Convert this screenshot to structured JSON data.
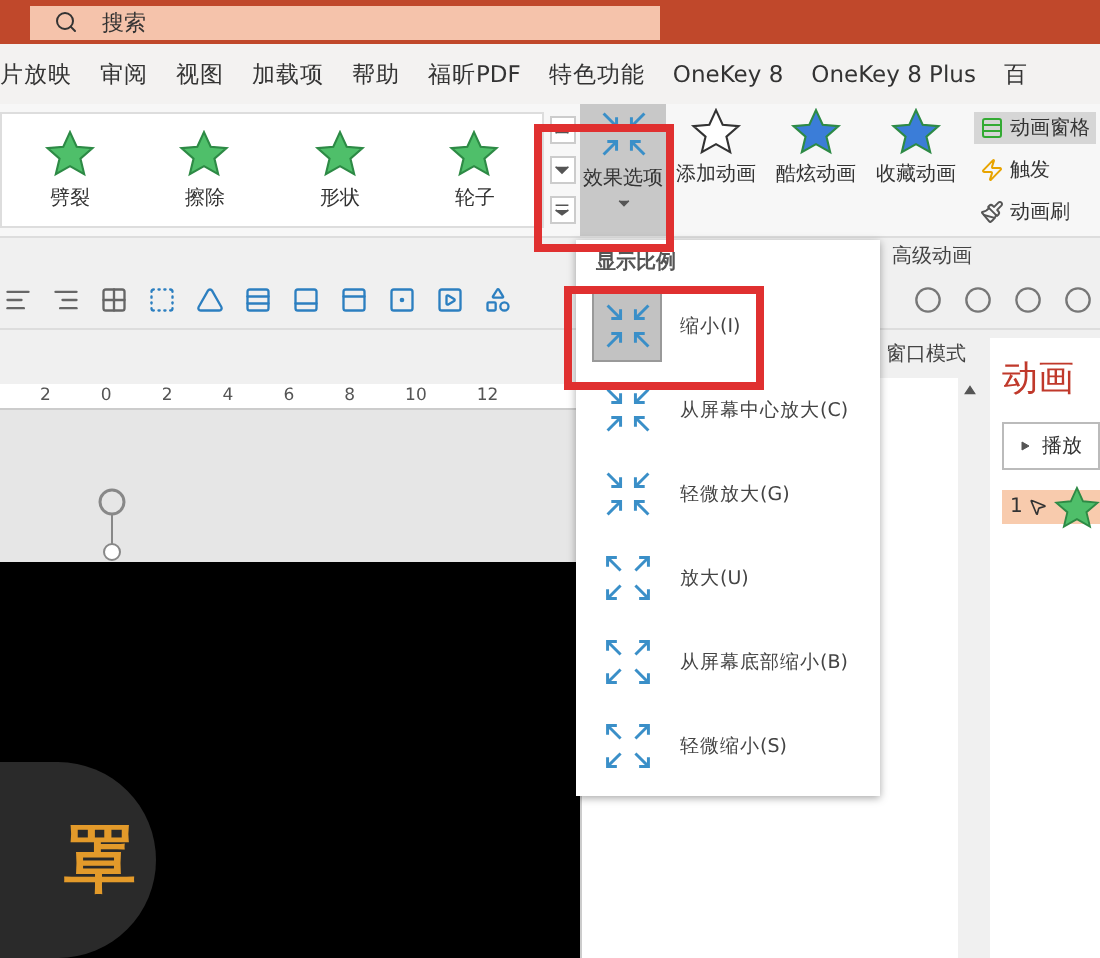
{
  "title_bar": {
    "search": {
      "placeholder": "搜索"
    }
  },
  "tabs": [
    {
      "label": "片放映"
    },
    {
      "label": "审阅"
    },
    {
      "label": "视图"
    },
    {
      "label": "加载项"
    },
    {
      "label": "帮助"
    },
    {
      "label": "福昕PDF"
    },
    {
      "label": "特色功能"
    },
    {
      "label": "OneKey 8"
    },
    {
      "label": "OneKey 8 Plus"
    },
    {
      "label": "百"
    }
  ],
  "ribbon": {
    "gallery": [
      {
        "label": "劈裂"
      },
      {
        "label": "擦除"
      },
      {
        "label": "形状"
      },
      {
        "label": "轮子"
      }
    ],
    "effect_options": {
      "label": "效果选项",
      "selected": true
    },
    "buttons": [
      {
        "label": "添加动画",
        "kind": "outline"
      },
      {
        "label": "酷炫动画",
        "kind": "fancy"
      },
      {
        "label": "收藏动画",
        "kind": "cloud"
      }
    ],
    "side_buttons": [
      {
        "label": "动画窗格",
        "kind": "pane",
        "selected": true
      },
      {
        "label": "触发",
        "kind": "trigger",
        "selected": false
      },
      {
        "label": "动画刷",
        "kind": "brush",
        "selected": false
      }
    ],
    "group_label": "高级动画"
  },
  "ruler": [
    "2",
    "0",
    "2",
    "4",
    "6",
    "8",
    "10",
    "12"
  ],
  "side_pane": {
    "tab": "窗口模式"
  },
  "animation_pane": {
    "title": "动画",
    "play_button": "播放",
    "items": [
      {
        "number": "1"
      }
    ]
  },
  "slide": {
    "text": "罩"
  },
  "dropdown": {
    "header": "显示比例",
    "items": [
      {
        "label": "缩小(I)",
        "kind": "shrink",
        "selected": true
      },
      {
        "label": "从屏幕中心放大(C)",
        "kind": "shrink",
        "selected": false
      },
      {
        "label": "轻微放大(G)",
        "kind": "shrink",
        "selected": false
      },
      {
        "label": "放大(U)",
        "kind": "grow",
        "selected": false
      },
      {
        "label": "从屏幕底部缩小(B)",
        "kind": "grow",
        "selected": false
      },
      {
        "label": "轻微缩小(S)",
        "kind": "grow",
        "selected": false
      }
    ]
  }
}
